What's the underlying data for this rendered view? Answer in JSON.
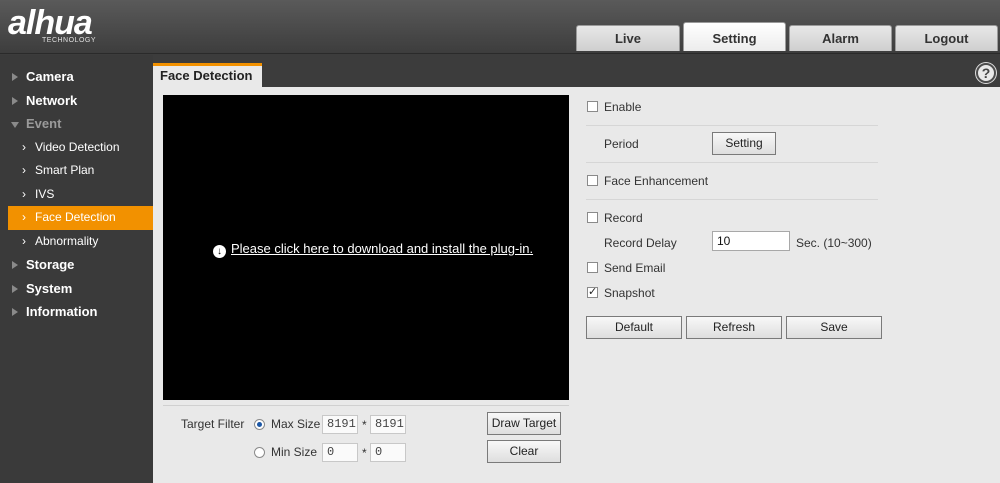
{
  "brand": {
    "logo": "alhua",
    "tagline": "TECHNOLOGY"
  },
  "tabs": [
    {
      "label": "Live",
      "active": false
    },
    {
      "label": "Setting",
      "active": true
    },
    {
      "label": "Alarm",
      "active": false
    },
    {
      "label": "Logout",
      "active": false
    }
  ],
  "sidebar": {
    "camera": "Camera",
    "network": "Network",
    "event": "Event",
    "video_detection": "Video Detection",
    "smart_plan": "Smart Plan",
    "ivs": "IVS",
    "face_detection": "Face Detection",
    "abnormality": "Abnormality",
    "storage": "Storage",
    "system": "System",
    "information": "Information"
  },
  "panel": {
    "title": "Face Detection",
    "help": "?"
  },
  "video": {
    "plugin_link": "Please click here to download and install the plug-in."
  },
  "filter": {
    "label": "Target Filter",
    "max_label": "Max Size",
    "max_w": "8191",
    "max_h": "8191",
    "min_label": "Min Size",
    "min_w": "0",
    "min_h": "0",
    "times": "*",
    "selected": "Max Size",
    "draw_target": "Draw Target",
    "clear": "Clear"
  },
  "settings": {
    "enable": {
      "label": "Enable",
      "checked": false
    },
    "period_label": "Period",
    "period_button": "Setting",
    "face_enhancement": {
      "label": "Face Enhancement",
      "checked": false
    },
    "record": {
      "label": "Record",
      "checked": false
    },
    "record_delay_label": "Record Delay",
    "record_delay_value": "10",
    "record_delay_hint": "Sec. (10~300)",
    "send_email": {
      "label": "Send Email",
      "checked": false
    },
    "snapshot": {
      "label": "Snapshot",
      "checked": true
    },
    "buttons": {
      "default": "Default",
      "refresh": "Refresh",
      "save": "Save"
    }
  },
  "colors": {
    "accent": "#f29100",
    "sidebar_bg": "#3a3a3a",
    "panel_bg": "#e9e9e9",
    "video_bg": "#000000"
  }
}
